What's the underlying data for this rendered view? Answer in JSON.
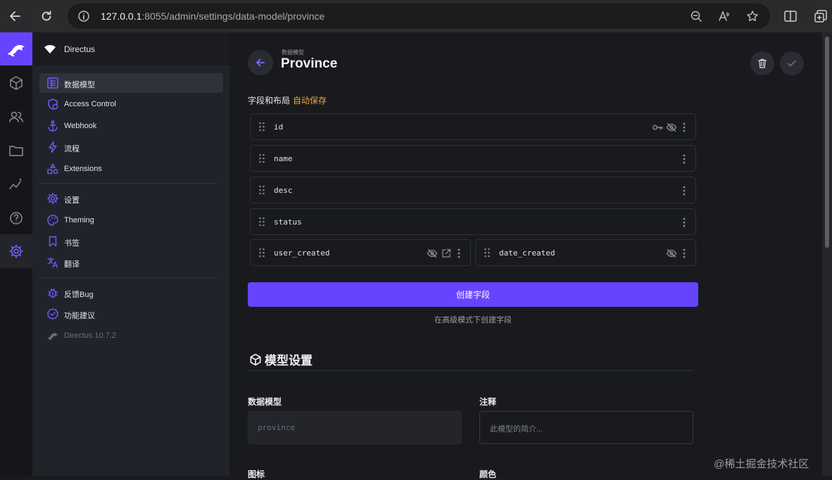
{
  "browser": {
    "url_host": "127.0.0.1",
    "url_path": ":8055/admin/settings/data-model/province"
  },
  "sidebar": {
    "project_name": "Directus",
    "items": [
      {
        "label": "数据模型",
        "icon": "data-model-icon"
      },
      {
        "label": "Access Control",
        "icon": "access-control-icon"
      },
      {
        "label": "Webhook",
        "icon": "anchor-icon"
      },
      {
        "label": "流程",
        "icon": "bolt-icon"
      },
      {
        "label": "Extensions",
        "icon": "extensions-icon"
      },
      {
        "label": "设置",
        "icon": "gear-icon"
      },
      {
        "label": "Theming",
        "icon": "palette-icon"
      },
      {
        "label": "书签",
        "icon": "bookmark-icon"
      },
      {
        "label": "翻译",
        "icon": "translate-icon"
      },
      {
        "label": "反馈Bug",
        "icon": "bug-icon"
      },
      {
        "label": "功能建议",
        "icon": "verified-icon"
      },
      {
        "label": "Directus 10.7.2",
        "icon": "directus-logo-icon"
      }
    ]
  },
  "header": {
    "breadcrumb": "数据模型",
    "title": "Province"
  },
  "fields_section": {
    "label": "字段和布局",
    "autosave": "自动保存",
    "fields": [
      "id",
      "name",
      "desc",
      "status",
      "user_created",
      "date_created"
    ],
    "create_button": "创建字段",
    "advanced_link": "在高级模式下创建字段"
  },
  "model_settings": {
    "title": "模型设置",
    "collection_label": "数据模型",
    "collection_value": "province",
    "note_label": "注释",
    "note_placeholder": "此模型的简介...",
    "icon_label": "图标",
    "color_label": "颜色"
  },
  "watermark": "@稀土掘金技术社区",
  "colors": {
    "accent": "#6644ff",
    "autosave": "#f0a33b"
  }
}
